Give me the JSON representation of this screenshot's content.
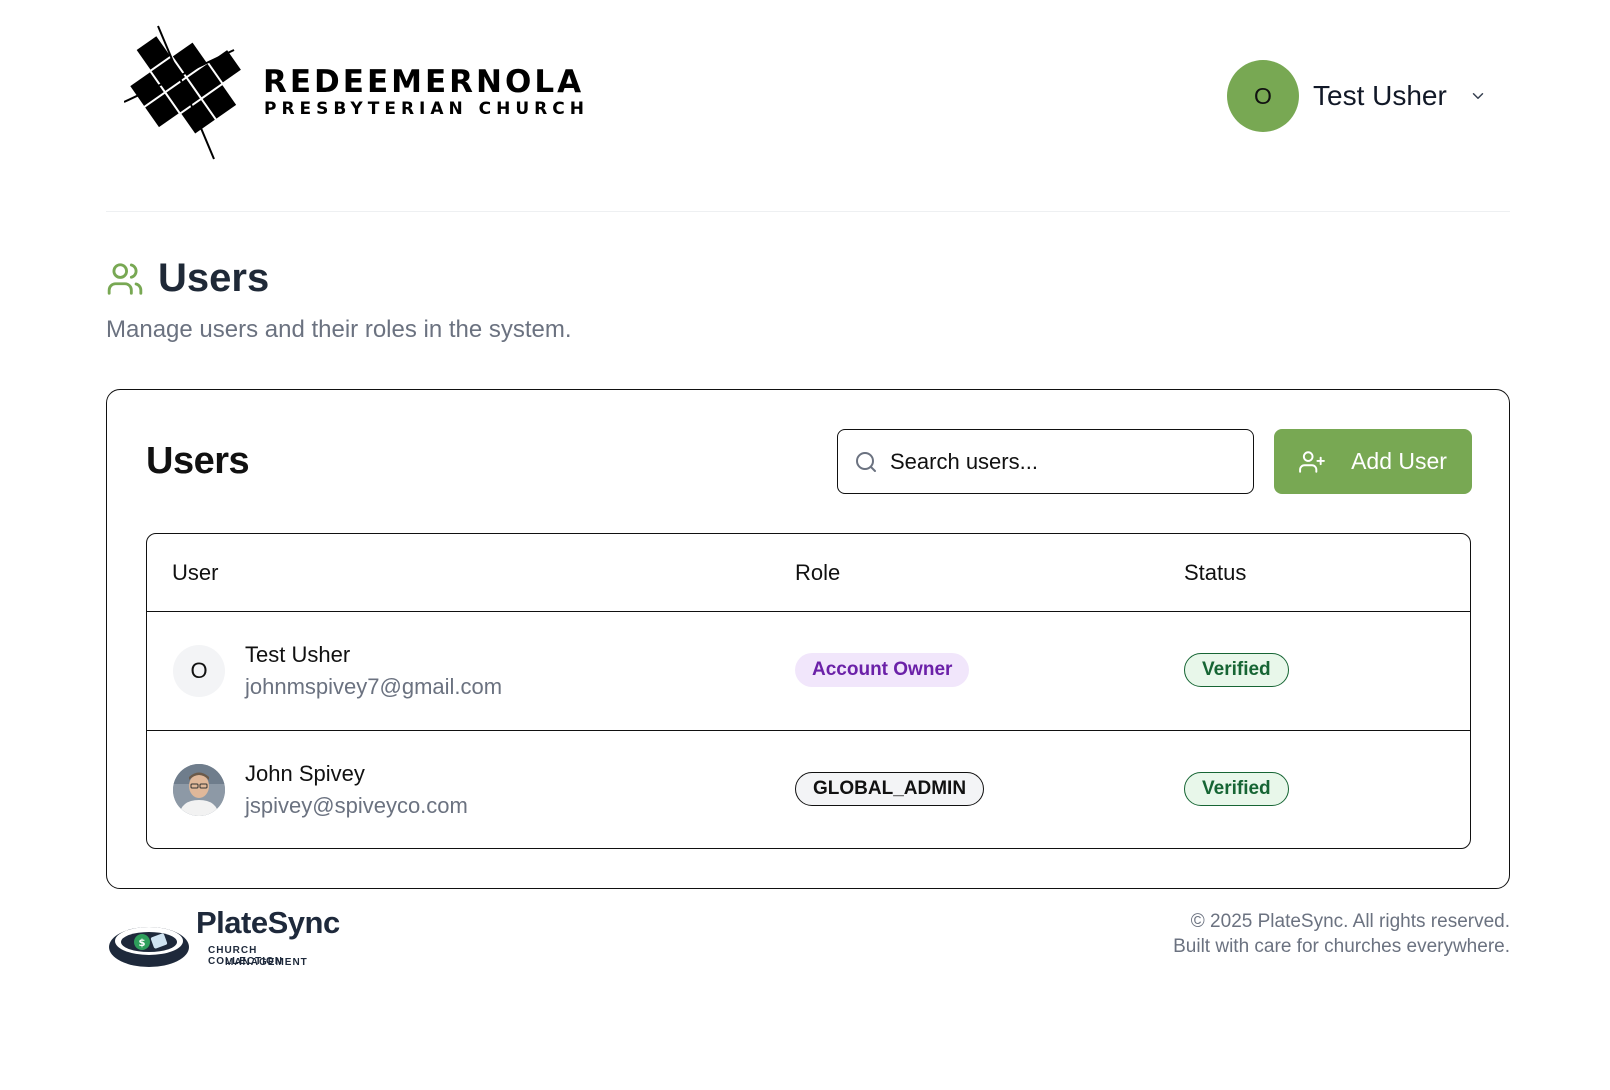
{
  "header": {
    "logo": {
      "line1": "REDEEMERNOLA",
      "line2": "PRESBYTERIAN CHURCH"
    },
    "user_menu": {
      "initial": "O",
      "name": "Test Usher",
      "icon": "chevron-down-icon",
      "avatar_color": "#78a853"
    }
  },
  "page": {
    "icon": "users-icon",
    "title": "Users",
    "subtitle": "Manage users and their roles in the system."
  },
  "card": {
    "title": "Users",
    "search": {
      "placeholder": "Search users...",
      "icon": "search-icon"
    },
    "add_button": {
      "label": "Add User",
      "icon": "user-plus-icon",
      "color": "#78a853"
    },
    "table": {
      "columns": [
        "User",
        "Role",
        "Status"
      ],
      "rows": [
        {
          "avatar": "O",
          "name": "Test Usher",
          "email": "johnmspivey7@gmail.com",
          "role": "Account Owner",
          "status": "Verified"
        },
        {
          "avatar": "photo",
          "name": "John Spivey",
          "email": "jspivey@spiveyco.com",
          "role": "GLOBAL_ADMIN",
          "status": "Verified"
        }
      ]
    }
  },
  "footer": {
    "brand": "PlateSync",
    "brand_sub1": "CHURCH COLLECTION",
    "brand_sub2": "MANAGEMENT",
    "copyright": "© 2025 PlateSync. All rights reserved.",
    "tagline": "Built with care for churches everywhere."
  },
  "colors": {
    "accent": "#78a853",
    "owner_badge_bg": "#f1e6fb",
    "owner_badge_text": "#6b21a8",
    "verified_bg": "#e8f7ea",
    "verified_text": "#166534"
  }
}
